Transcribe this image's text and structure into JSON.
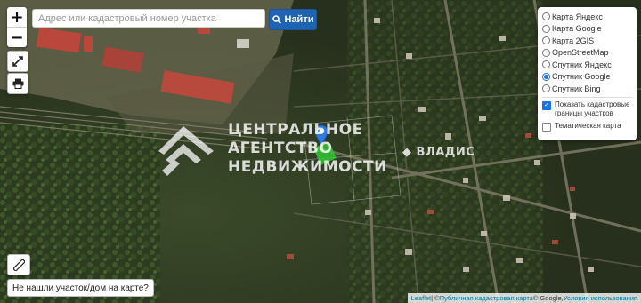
{
  "search": {
    "placeholder": "Адрес или кадастровый номер участка",
    "value": ""
  },
  "find_button": {
    "label": "Найти",
    "icon": "search-icon"
  },
  "zoom": {
    "in_label": "+",
    "out_label": "−"
  },
  "tools": {
    "fullscreen_icon": "expand-icon",
    "print_icon": "print-icon",
    "ruler_icon": "ruler-icon"
  },
  "layers": {
    "options": [
      {
        "label": "Карта Яндекс",
        "selected": false
      },
      {
        "label": "Карта Google",
        "selected": false
      },
      {
        "label": "Карта 2GIS",
        "selected": false
      },
      {
        "label": "OpenStreetMap",
        "selected": false
      },
      {
        "label": "Спутник Яндекс",
        "selected": false
      },
      {
        "label": "Спутник Google",
        "selected": true
      },
      {
        "label": "Спутник Bing",
        "selected": false
      }
    ],
    "overlays": [
      {
        "label": "Показать кадастровые границы участков",
        "checked": true
      },
      {
        "label": "Тематическая карта",
        "checked": false
      }
    ]
  },
  "missing_parcel_button": {
    "label": "Не нашли участок/дом на карте?"
  },
  "watermark": {
    "line1": "ЦЕНТРАЛЬНОЕ",
    "line2": "АГЕНТСТВО",
    "line3": "НЕДВИЖИМОСТИ",
    "brand": "ВЛАДИС"
  },
  "attribution": {
    "leaflet": "Leaflet",
    "sep": " | © ",
    "cadastral": "Публичная кадастровая карта",
    "google": " © Google, ",
    "terms": "Условия использования"
  },
  "colors": {
    "accent": "#1f63b3",
    "marker": "#2f7bdc",
    "parcel": "#32c832"
  }
}
